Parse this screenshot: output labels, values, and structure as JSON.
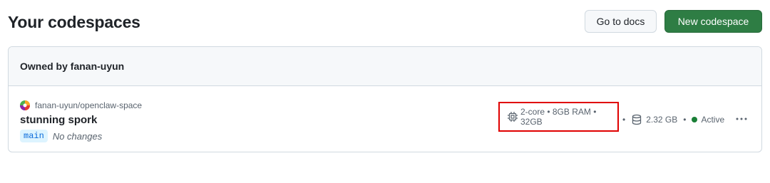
{
  "header": {
    "title": "Your codespaces",
    "docs_label": "Go to docs",
    "new_label": "New codespace"
  },
  "group": {
    "owner_label": "Owned by fanan-uyun"
  },
  "codespace": {
    "repo": "fanan-uyun/openclaw-space",
    "name": "stunning spork",
    "branch": "main",
    "changes": "No changes",
    "spec": "2-core • 8GB RAM • 32GB",
    "sep": "•",
    "storage": "2.32 GB",
    "status": "Active"
  },
  "colors": {
    "primary_button": "#2e7d44",
    "status_active": "#1a7f37",
    "highlight_box": "#e00000",
    "branch_bg": "#ddf4ff"
  },
  "icons": {
    "spec": "cpu-icon",
    "storage": "database-icon",
    "status": "status-dot",
    "more": "kebab-icon"
  }
}
